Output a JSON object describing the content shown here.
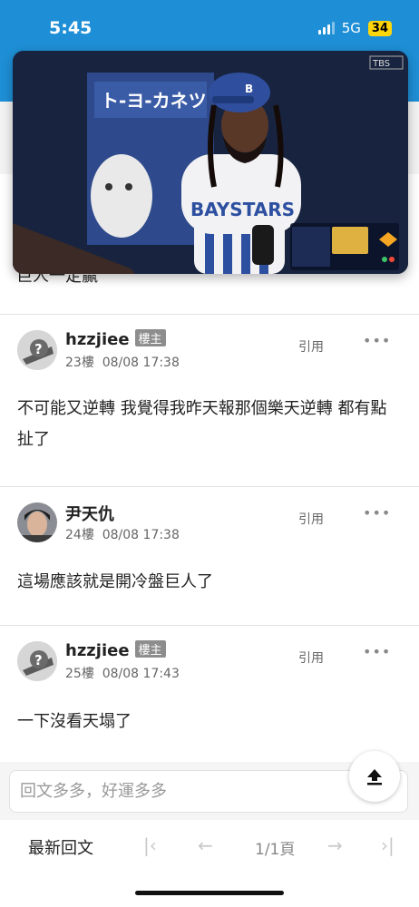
{
  "status_bar": {
    "time": "5:45",
    "network": "5G",
    "battery": "34"
  },
  "video": {
    "channel_logo": "TBS"
  },
  "previous_post_text": "巨人一定贏",
  "posts": [
    {
      "username": "hzzjiee",
      "owner_badge": "樓主",
      "floor": "23樓",
      "datetime": "08/08 17:38",
      "quote_label": "引用",
      "more": "•••",
      "content": "不可能又逆轉 我覺得我昨天報那個樂天逆轉 都有點扯了"
    },
    {
      "username": "尹天仇",
      "owner_badge": "",
      "floor": "24樓",
      "datetime": "08/08 17:38",
      "quote_label": "引用",
      "more": "•••",
      "content": "這場應該就是開冷盤巨人了"
    },
    {
      "username": "hzzjiee",
      "owner_badge": "樓主",
      "floor": "25樓",
      "datetime": "08/08 17:43",
      "quote_label": "引用",
      "more": "•••",
      "content": "一下沒看天塌了"
    }
  ],
  "reply": {
    "placeholder": "回文多多，好運多多"
  },
  "bottom_nav": {
    "latest": "最新回文",
    "page_indicator": "1/1頁",
    "first_icon": "|‹",
    "prev_icon": "←",
    "next_icon": "→",
    "last_icon": "›|"
  },
  "colors": {
    "header_blue": "#1e8fd6",
    "badge_grey": "#8d8d8d"
  }
}
